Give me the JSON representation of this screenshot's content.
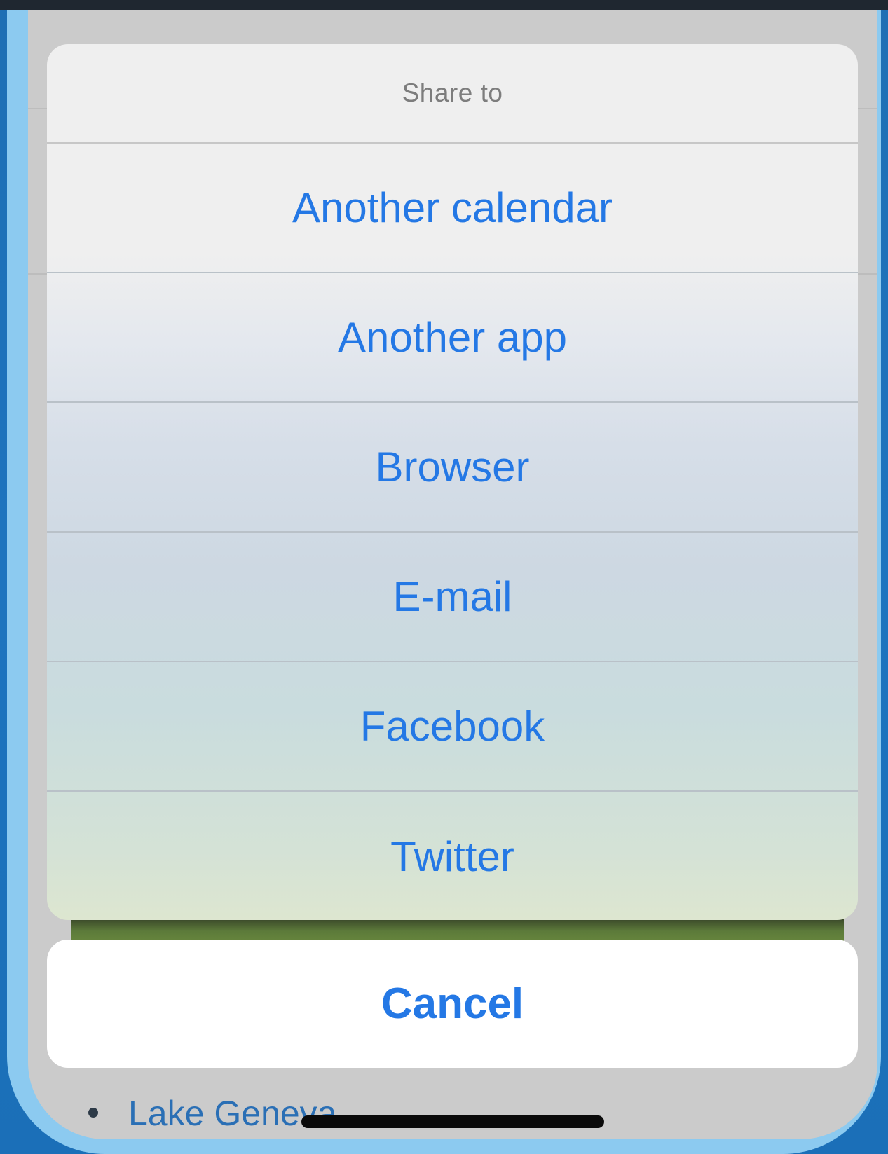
{
  "action_sheet": {
    "title": "Share to",
    "options": [
      {
        "label": "Another calendar"
      },
      {
        "label": "Another app"
      },
      {
        "label": "Browser"
      },
      {
        "label": "E-mail"
      },
      {
        "label": "Facebook"
      },
      {
        "label": "Twitter"
      }
    ],
    "cancel_label": "Cancel"
  },
  "background_page": {
    "list_items": [
      {
        "label": "Lake Geneva"
      }
    ]
  },
  "colors": {
    "accent": "#2478e5",
    "sheet_background": "#efefef",
    "dimmed_screen": "#cbcbcb"
  }
}
